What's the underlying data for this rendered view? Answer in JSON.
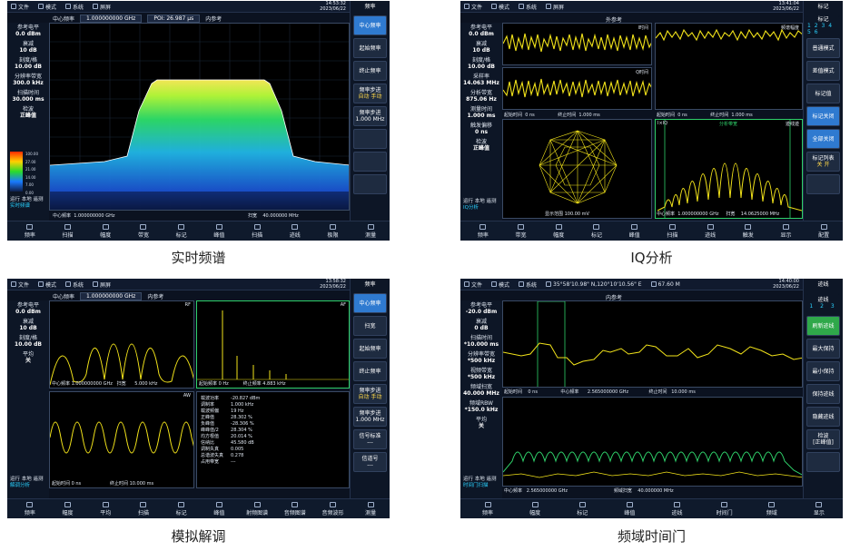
{
  "top_icons": [
    "文件",
    "模式",
    "系统",
    "屏屏"
  ],
  "p1": {
    "time": "14:53:32",
    "date": "2023/06/22",
    "right_title": "频率",
    "header": {
      "center": "中心频率",
      "center_value": "1.000000000 GHz",
      "poi": "POI: 26.987 µs",
      "ref": "内参考"
    },
    "left": [
      {
        "label": "参考电平",
        "value": "0.0 dBm"
      },
      {
        "label": "衰减",
        "value": "10 dB"
      },
      {
        "label": "刻度/格",
        "value": "10.00 dB"
      },
      {
        "label": "分辨率带宽",
        "value": "300.0 kHz"
      },
      {
        "label": "扫描时间",
        "value": "30.000 ms"
      },
      {
        "label": "检波",
        "value": "正峰值"
      }
    ],
    "legend_ticks": [
      "100.00",
      "27.00",
      "21.00",
      "14.00",
      "7.00",
      "0.00"
    ],
    "status": [
      "运行 本地 遥测",
      "实时频谱"
    ],
    "footer": {
      "center": "中心频率",
      "center_value": "1.000000000 GHz",
      "span": "扫宽",
      "span_value": "40.000000 MHz"
    },
    "buttons": [
      {
        "label": "中心频率",
        "active": true
      },
      {
        "label": "起始频率"
      },
      {
        "label": "终止频率"
      },
      {
        "label": "频率步进",
        "sub": "自动  手动"
      },
      {
        "label": "频率步进",
        "value": "1.000 MHz"
      }
    ],
    "bottom": [
      "频率",
      "扫描",
      "幅度",
      "带宽",
      "标记",
      "峰值",
      "扫描",
      "迹线",
      "极限",
      "测量"
    ]
  },
  "p2": {
    "time": "13:41:04",
    "date": "2023/06/22",
    "right_title": "标记",
    "header": {
      "ref": "外参考"
    },
    "left": [
      {
        "label": "参考电平",
        "value": "0.0 dBm"
      },
      {
        "label": "衰减",
        "value": "10 dB"
      },
      {
        "label": "刻度/格",
        "value": "10.00 dB"
      },
      {
        "label": "采样率",
        "value": "14.063 MHz"
      },
      {
        "label": "分析带宽",
        "value": "875.06 Hz"
      },
      {
        "label": "测量时间",
        "value": "1.000 ms"
      },
      {
        "label": "触发偏移",
        "value": "0 ns"
      },
      {
        "label": "检波",
        "value": "正峰值"
      }
    ],
    "status": [
      "运行 本地 遥测",
      "IQ分析"
    ],
    "plot_labels": {
      "i": "I时间",
      "q": "Q时间",
      "mag": "频谱幅度",
      "iq": "I×IQ",
      "spec": "分析带宽",
      "trace": "迹线迹"
    },
    "time_start": "起始时间",
    "time_start_v": "0 ns",
    "time_stop": "终止时间",
    "time_stop_v": "1.000 ms",
    "iq_scale": "显示范围 100.00 mV",
    "spec_footer": {
      "center": "中心频率",
      "center_value": "1.000000000 GHz",
      "span": "扫宽",
      "span_value": "14.0625000 MHz"
    },
    "marker_header": {
      "title": "标记",
      "nums": [
        "1",
        "2",
        "3",
        "4",
        "5",
        "6"
      ]
    },
    "buttons": [
      {
        "label": "普通模式"
      },
      {
        "label": "差值模式"
      },
      {
        "label": "标记值"
      },
      {
        "label": "标记关闭",
        "active": true
      },
      {
        "label": "全部关闭",
        "active": true
      },
      {
        "label": "标记列表",
        "sub": "关  开"
      }
    ],
    "bottom": [
      "频率",
      "带宽",
      "幅度",
      "标记",
      "峰值",
      "扫描",
      "迹线",
      "触发",
      "显示",
      "配置"
    ]
  },
  "p3": {
    "time": "13:58:32",
    "date": "2023/06/22",
    "right_title": "频率",
    "header": {
      "center": "中心频率",
      "center_value": "1.000000000 GHz",
      "ref": "内参考"
    },
    "left": [
      {
        "label": "参考电平",
        "value": "0.0 dBm"
      },
      {
        "label": "衰减",
        "value": "10 dB"
      },
      {
        "label": "刻度/格",
        "value": "10.00 dB"
      },
      {
        "label": "平均",
        "value": "关"
      }
    ],
    "status": [
      "运行 本地 遥测",
      "解调分析"
    ],
    "rf": {
      "tag": "RF",
      "center": "中心频率",
      "center_value": "1.000000000 GHz",
      "span": "扫宽",
      "span_value": "5.000 kHz"
    },
    "af": {
      "tag": "AF",
      "left": "起始频率",
      "left_v": "0 Hz",
      "right": "终止频率",
      "right_v": "4.883 kHz"
    },
    "aw": {
      "tag": "AW",
      "left": "起始时间",
      "left_v": "0 ns",
      "right": "终止时间",
      "right_v": "10.000 ms"
    },
    "table": [
      [
        "载波功率",
        "-20.827 dBm"
      ],
      [
        "调制率",
        "1.000 kHz"
      ],
      [
        "载波频偏",
        "19 Hz"
      ],
      [
        "正峰值",
        "28.302 %"
      ],
      [
        "负峰值",
        "-28.306 %"
      ],
      [
        "峰峰值/2",
        "28.304 %"
      ],
      [
        "均方根值",
        "20.014 %"
      ],
      [
        "信纳比",
        "45.580 dB"
      ],
      [
        "调制失真",
        "0.005"
      ],
      [
        "总谐波失真",
        "0.278"
      ],
      [
        "占用带宽",
        "---"
      ]
    ],
    "buttons": [
      {
        "label": "中心频率",
        "active": true
      },
      {
        "label": "扫宽"
      },
      {
        "label": "起始频率"
      },
      {
        "label": "终止频率"
      },
      {
        "label": "频率步进",
        "sub": "自动  手动"
      },
      {
        "label": "频率步进",
        "value": "1.000 MHz"
      },
      {
        "label": "信号标准",
        "value": "---"
      },
      {
        "label": "信道号",
        "value": "---"
      }
    ],
    "bottom": [
      "频率",
      "幅度",
      "平均",
      "扫描",
      "标记",
      "峰值",
      "射频图谱",
      "音频图谱",
      "音频波形",
      "测量"
    ]
  },
  "p4": {
    "time": "14:40:00",
    "date": "2023/06/22",
    "gps": "35°58'10.98\" N,120°10'10.56\" E",
    "gps_alt": "67.60 M",
    "right_title": "迹线",
    "header": {
      "ref": "内参考"
    },
    "left": [
      {
        "label": "参考电平",
        "value": "-20.0 dBm"
      },
      {
        "label": "衰减",
        "value": "0 dB"
      },
      {
        "label": "扫描时间",
        "value": "*10.000 ms"
      },
      {
        "label": "分辨率带宽",
        "value": "*500 kHz"
      },
      {
        "label": "视频带宽",
        "value": "*500 kHz"
      },
      {
        "label": "频域扫宽",
        "value": "40.000 MHz"
      },
      {
        "label": "频域RBW",
        "value": "*150.0 kHz"
      },
      {
        "label": "平均",
        "value": "关"
      }
    ],
    "status": [
      "运行 本地 遥测",
      "时间门扫描"
    ],
    "top_footer": {
      "start": "起始时间",
      "start_v": "0 ns",
      "center": "中心频率",
      "center_v": "2.565000000 GHz",
      "stop": "终止时间",
      "stop_v": "10.000 ms"
    },
    "bot_footer": {
      "center": "中心频率",
      "center_v": "2.565000000 GHz",
      "span": "频域扫宽",
      "span_v": "40.000000 MHz"
    },
    "trace_header": {
      "title": "迹线",
      "nums": [
        "1",
        "2",
        "3"
      ]
    },
    "buttons": [
      {
        "label": "刷新迹线",
        "green": true
      },
      {
        "label": "最大保持"
      },
      {
        "label": "最小保持"
      },
      {
        "label": "保持迹线"
      },
      {
        "label": "隐藏迹线"
      },
      {
        "label": "检波",
        "value": "[正峰值]"
      }
    ],
    "bottom": [
      "频率",
      "幅度",
      "标记",
      "峰值",
      "迹线",
      "时间门",
      "频域",
      "显示"
    ]
  },
  "captions": [
    "实时频谱",
    "IQ分析",
    "模拟解调",
    "频域时间门"
  ]
}
